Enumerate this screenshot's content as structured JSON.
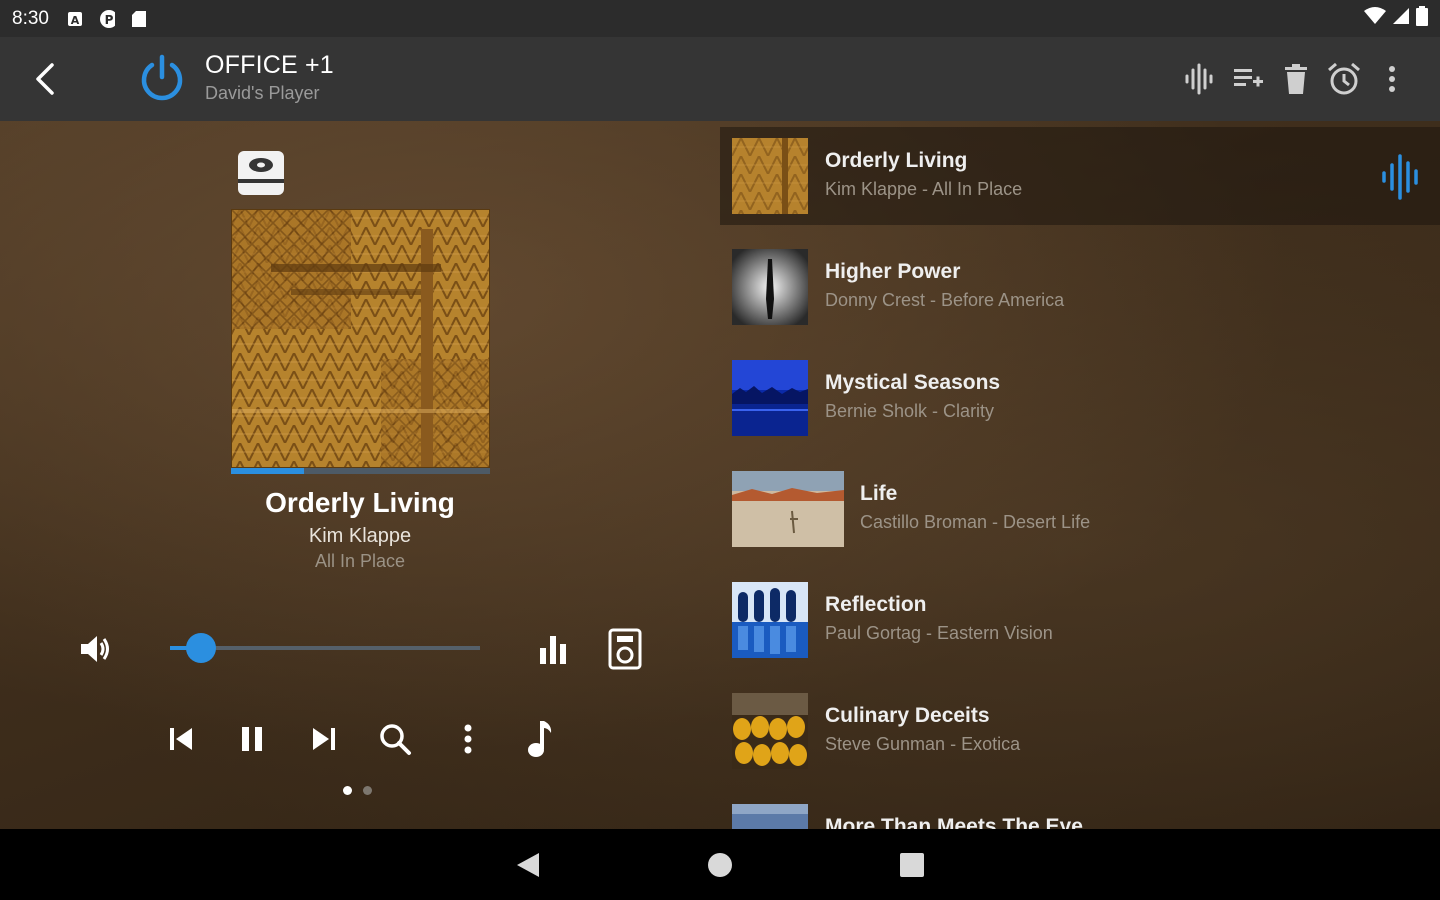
{
  "status_bar": {
    "time": "8:30",
    "left_icons": [
      "notification-a-icon",
      "notification-p-icon",
      "sd-card-icon"
    ],
    "right_icons": [
      "wifi-icon",
      "signal-icon",
      "battery-icon"
    ]
  },
  "app_bar": {
    "title": "OFFICE +1",
    "subtitle": "David's Player",
    "accent": "#2b8fe0",
    "icons": [
      "back-icon",
      "power-icon",
      "waveform-icon",
      "playlist-add-icon",
      "trash-icon",
      "alarm-icon",
      "more-vert-icon"
    ]
  },
  "now_playing": {
    "title": "Orderly Living",
    "artist": "Kim Klappe",
    "album": "All In Place",
    "progress": 0.28,
    "volume": 0.1
  },
  "controls": [
    "skip-previous-icon",
    "pause-icon",
    "skip-next-icon",
    "search-icon",
    "more-vert-icon",
    "music-note-icon"
  ],
  "page_indicator": {
    "count": 2,
    "active": 0
  },
  "queue": [
    {
      "title": "Orderly Living",
      "subtitle": "Kim Klappe - All In Place",
      "active": true
    },
    {
      "title": "Higher Power",
      "subtitle": "Donny Crest - Before America"
    },
    {
      "title": "Mystical Seasons",
      "subtitle": "Bernie Sholk - Clarity"
    },
    {
      "title": "Life",
      "subtitle": "Castillo Broman - Desert Life"
    },
    {
      "title": "Reflection",
      "subtitle": "Paul Gortag - Eastern Vision"
    },
    {
      "title": "Culinary Deceits",
      "subtitle": "Steve Gunman - Exotica"
    },
    {
      "title": "More Than Meets The Eye",
      "subtitle": ""
    }
  ],
  "nav_bar": {
    "icons": [
      "back-triangle-icon",
      "home-circle-icon",
      "recents-square-icon"
    ]
  }
}
